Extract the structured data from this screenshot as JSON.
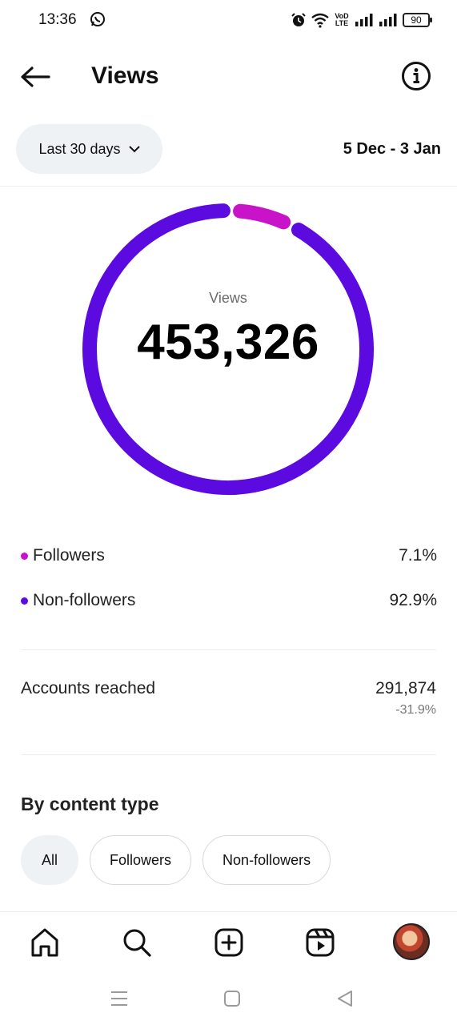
{
  "status_bar": {
    "time": "13:36",
    "volte_top": "VoD",
    "volte_bottom": "LTE",
    "battery": "90"
  },
  "header": {
    "title": "Views"
  },
  "filters": {
    "range_label": "Last 30 days",
    "date_range": "5 Dec - 3 Jan"
  },
  "summary": {
    "caption": "Views",
    "total": "453,326"
  },
  "breakdown": [
    {
      "label": "Followers",
      "value": "7.1%",
      "share": 7.1,
      "color": "#c913c9"
    },
    {
      "label": "Non-followers",
      "value": "92.9%",
      "share": 92.9,
      "color": "#5b0be0"
    }
  ],
  "accounts_reached": {
    "label": "Accounts reached",
    "value": "291,874",
    "change": "-31.9%"
  },
  "content_type": {
    "title": "By content type",
    "chips": [
      {
        "label": "All",
        "active": true
      },
      {
        "label": "Followers",
        "active": false
      },
      {
        "label": "Non-followers",
        "active": false
      }
    ]
  },
  "bottom_nav": [
    "home-icon",
    "search-icon",
    "create-icon",
    "reels-icon",
    "profile-avatar"
  ],
  "colors": {
    "followers": "#c913c9",
    "non_followers": "#5b0be0",
    "chip_active": "#eff2f5"
  }
}
